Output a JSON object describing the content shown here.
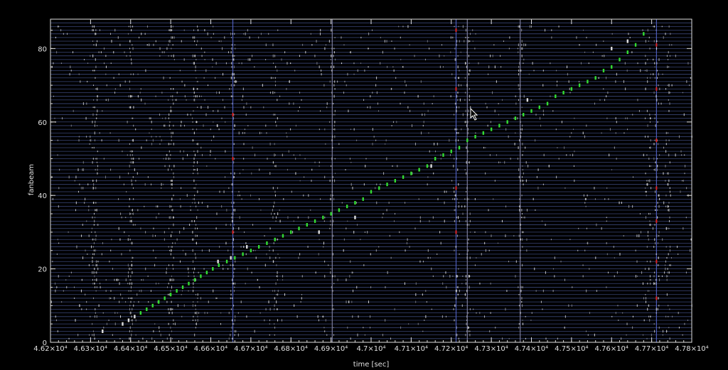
{
  "chart_data": {
    "type": "scatter",
    "title": "",
    "xlabel": "time [sec]",
    "ylabel": "fanbeam",
    "xlim": [
      46200,
      47800
    ],
    "ylim": [
      0,
      88
    ],
    "grid": "horizontal lines at every fanbeam index",
    "x_ticks": [
      46200,
      46300,
      46400,
      46500,
      46600,
      46700,
      46800,
      46900,
      47000,
      47100,
      47200,
      47300,
      47400,
      47500,
      47600,
      47700,
      47800
    ],
    "x_tick_labels": [
      "4.62×10⁴",
      "4.63×10⁴",
      "4.64×10⁴",
      "4.65×10⁴",
      "4.66×10⁴",
      "4.67×10⁴",
      "4.68×10⁴",
      "4.69×10⁴",
      "4.7×10⁴",
      "4.71×10⁴",
      "4.72×10⁴",
      "4.73×10⁴",
      "4.74×10⁴",
      "4.75×10⁴",
      "4.76×10⁴",
      "4.77×10⁴",
      "4.78×10⁴"
    ],
    "y_ticks": [
      0,
      20,
      40,
      60,
      80
    ],
    "y_tick_labels": [
      "0",
      "20",
      "40",
      "60",
      "80"
    ],
    "series": [
      {
        "color": "#33dd33",
        "x": [
          46425,
          46440,
          46455,
          46470,
          46485,
          46500,
          46515,
          46530,
          46545,
          46560,
          46575,
          46590,
          46605,
          46620,
          46640,
          46660,
          46680,
          46700,
          46720,
          46740,
          46760,
          46780,
          46800,
          46820,
          46840,
          46860,
          46880,
          46900,
          46920,
          46940,
          46960,
          46980,
          47000,
          47020,
          47040,
          47060,
          47080,
          47100,
          47120,
          47140,
          47160,
          47180,
          47200,
          47220,
          47240,
          47260,
          47280,
          47300,
          47320,
          47340,
          47360,
          47380,
          47400,
          47420,
          47440,
          47460,
          47480,
          47500,
          47520,
          47540,
          47560,
          47580,
          47600,
          47620,
          47640,
          47660,
          47680
        ],
        "y": [
          8,
          9,
          10,
          11,
          12,
          13,
          14,
          15,
          16,
          17,
          18,
          19,
          20,
          21,
          22,
          23,
          24,
          25,
          26,
          27,
          28,
          29,
          30,
          31,
          32,
          33,
          34,
          35,
          36,
          37,
          38,
          39,
          41,
          42,
          43,
          44,
          45,
          46,
          47,
          48,
          50,
          51,
          52,
          53,
          55,
          56,
          57,
          58,
          59,
          60,
          61,
          62,
          63,
          64,
          65,
          67,
          68,
          69,
          70,
          71,
          72,
          74,
          75,
          77,
          79,
          81,
          84
        ]
      },
      {
        "color": "#dddddd",
        "x": [
          46330,
          46380,
          46395,
          46410,
          46618,
          46650,
          46690,
          46870,
          46960,
          47150,
          47390,
          47600,
          47640
        ],
        "y": [
          3,
          5,
          6,
          7,
          22,
          23,
          26,
          30,
          34,
          48,
          66,
          80,
          82
        ]
      }
    ],
    "vertical_bands": [
      {
        "x": 46655,
        "color": "#5566cc"
      },
      {
        "x": 46903,
        "color": "#8888aa"
      },
      {
        "x": 47212,
        "color": "#5566cc"
      },
      {
        "x": 47240,
        "color": "#8888aa"
      },
      {
        "x": 47372,
        "color": "#8888aa"
      },
      {
        "x": 47712,
        "color": "#5566cc"
      }
    ],
    "red_marks": [
      {
        "x": 46655,
        "y": 30
      },
      {
        "x": 46655,
        "y": 50
      },
      {
        "x": 46655,
        "y": 62
      },
      {
        "x": 47212,
        "y": 30
      },
      {
        "x": 47212,
        "y": 42
      },
      {
        "x": 47212,
        "y": 69
      },
      {
        "x": 47212,
        "y": 85
      },
      {
        "x": 47712,
        "y": 12
      },
      {
        "x": 47712,
        "y": 22
      },
      {
        "x": 47712,
        "y": 33
      },
      {
        "x": 47712,
        "y": 42
      },
      {
        "x": 47712,
        "y": 55
      },
      {
        "x": 47712,
        "y": 69
      },
      {
        "x": 47712,
        "y": 81
      }
    ],
    "colors": {
      "background": "#000000",
      "axes": "#e0e0e0",
      "gridline": "#3a4677",
      "noise": "#d8d8d8",
      "track": "#33dd33",
      "red": "#dd2222"
    }
  }
}
